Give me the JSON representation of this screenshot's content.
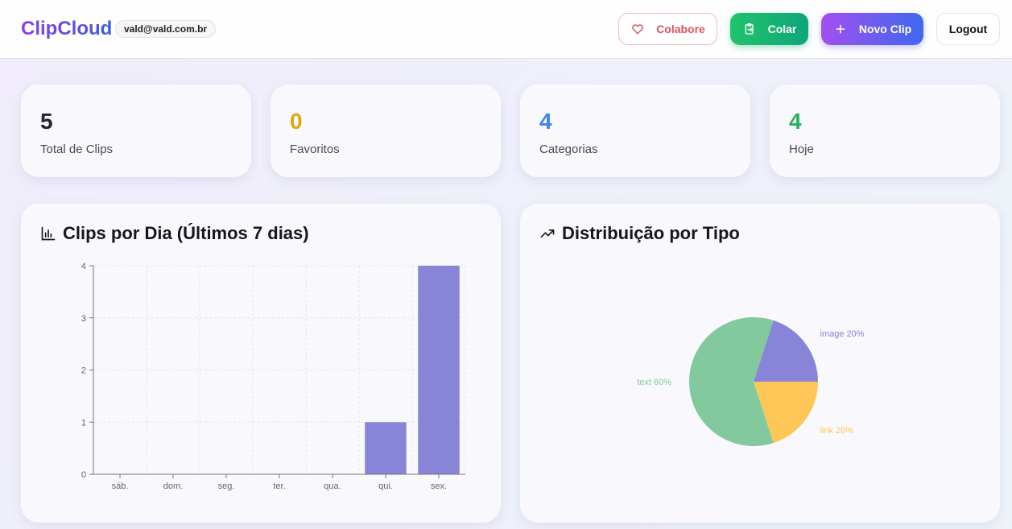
{
  "header": {
    "brand": "ClipCloud",
    "user_email": "vald@vald.com.br",
    "buttons": {
      "colabore": "Colabore",
      "colar": "Colar",
      "novo_clip": "Novo Clip",
      "logout": "Logout"
    },
    "icons": {
      "colabore": "heart-icon",
      "colar": "clipboard-icon",
      "novo_clip": "plus-icon"
    }
  },
  "stats": [
    {
      "value": "5",
      "label": "Total de Clips",
      "color": "#1f2430"
    },
    {
      "value": "0",
      "label": "Favoritos",
      "color": "#e0a710"
    },
    {
      "value": "4",
      "label": "Categorias",
      "color": "#3c82f0"
    },
    {
      "value": "4",
      "label": "Hoje",
      "color": "#22b45a"
    }
  ],
  "charts": {
    "bar_title": "Clips por Dia (Últimos 7 dias)",
    "bar_icon": "bar-chart-icon",
    "pie_title": "Distribuição por Tipo",
    "pie_icon": "trending-up-icon"
  },
  "chart_data": [
    {
      "type": "bar",
      "title": "Clips por Dia (Últimos 7 dias)",
      "categories": [
        "sáb.",
        "dom.",
        "seg.",
        "ter.",
        "qua.",
        "qui.",
        "sex."
      ],
      "values": [
        0,
        0,
        0,
        0,
        0,
        1,
        4
      ],
      "ylim": [
        0,
        4
      ],
      "yticks": [
        0,
        1,
        2,
        3,
        4
      ],
      "grid": true,
      "color": "#8884d8"
    },
    {
      "type": "pie",
      "title": "Distribuição por Tipo",
      "slices": [
        {
          "label": "image",
          "value": 20,
          "display": "image 20%",
          "color": "#8884d8"
        },
        {
          "label": "link",
          "value": 20,
          "display": "link 20%",
          "color": "#ffc658"
        },
        {
          "label": "text",
          "value": 60,
          "display": "text 60%",
          "color": "#82ca9d"
        }
      ]
    }
  ]
}
